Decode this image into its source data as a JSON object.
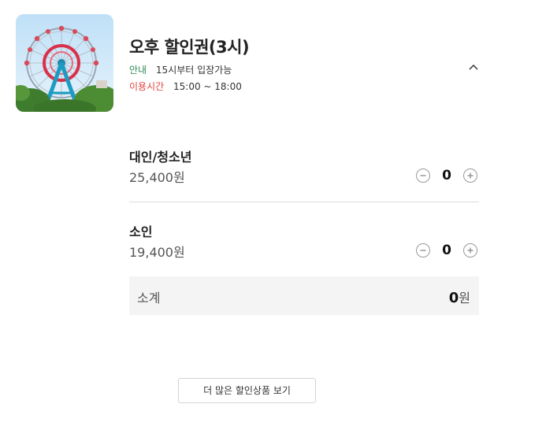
{
  "product": {
    "image_icon": "ferris-wheel-photo",
    "title": "오후 할인권(3시)",
    "guide_label": "안내",
    "guide_value": "15시부터 입장가능",
    "time_label": "이용시간",
    "time_value": "15:00 ~ 18:00",
    "toggle_icon": "chevron-up-icon"
  },
  "tickets": [
    {
      "name": "대인/청소년",
      "price": "25,400원",
      "count": "0"
    },
    {
      "name": "소인",
      "price": "19,400원",
      "count": "0"
    }
  ],
  "subtotal": {
    "label": "소계",
    "amount": "0",
    "unit": "원"
  },
  "more_button": "더 많은 할인상품 보기",
  "colors": {
    "guide": "#2e8b57",
    "time": "#e0443e",
    "subtotal_bg": "#f4f4f4"
  }
}
